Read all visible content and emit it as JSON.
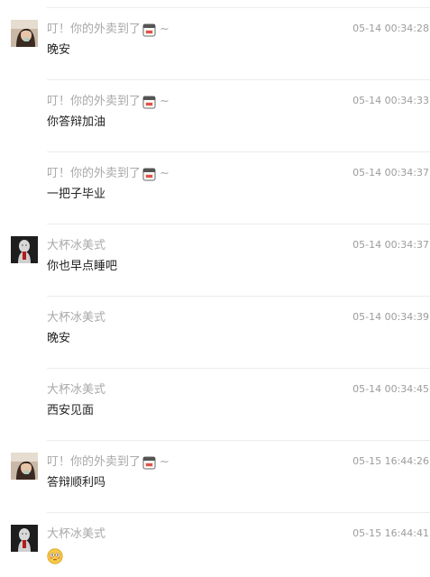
{
  "messages": [
    {
      "sender": "叮！你的外卖到了",
      "sender_suffix": "~",
      "sender_has_food_icon": true,
      "avatar": "girl-photo",
      "show_avatar": true,
      "time": "05-14 00:34:28",
      "text": "晚安"
    },
    {
      "sender": "叮！你的外卖到了",
      "sender_suffix": "~",
      "sender_has_food_icon": true,
      "avatar": "",
      "show_avatar": false,
      "time": "05-14 00:34:33",
      "text": "你答辩加油"
    },
    {
      "sender": "叮！你的外卖到了",
      "sender_suffix": "~",
      "sender_has_food_icon": true,
      "avatar": "",
      "show_avatar": false,
      "time": "05-14 00:34:37",
      "text": "一把子毕业"
    },
    {
      "sender": "大杯冰美式",
      "sender_suffix": "",
      "sender_has_food_icon": false,
      "avatar": "statue-photo",
      "show_avatar": true,
      "time": "05-14 00:34:37",
      "text": "你也早点睡吧"
    },
    {
      "sender": "大杯冰美式",
      "sender_suffix": "",
      "sender_has_food_icon": false,
      "avatar": "",
      "show_avatar": false,
      "time": "05-14 00:34:39",
      "text": "晚安"
    },
    {
      "sender": "大杯冰美式",
      "sender_suffix": "",
      "sender_has_food_icon": false,
      "avatar": "",
      "show_avatar": false,
      "time": "05-14 00:34:45",
      "text": "西安见面"
    },
    {
      "sender": "叮！你的外卖到了",
      "sender_suffix": "~",
      "sender_has_food_icon": true,
      "avatar": "girl-photo",
      "show_avatar": true,
      "time": "05-15 16:44:26",
      "text": "答辩顺利吗"
    },
    {
      "sender": "大杯冰美式",
      "sender_suffix": "",
      "sender_has_food_icon": false,
      "avatar": "statue-photo",
      "show_avatar": true,
      "time": "05-15 16:44:41",
      "text": "",
      "emoji": "flushed-face-icon"
    }
  ]
}
